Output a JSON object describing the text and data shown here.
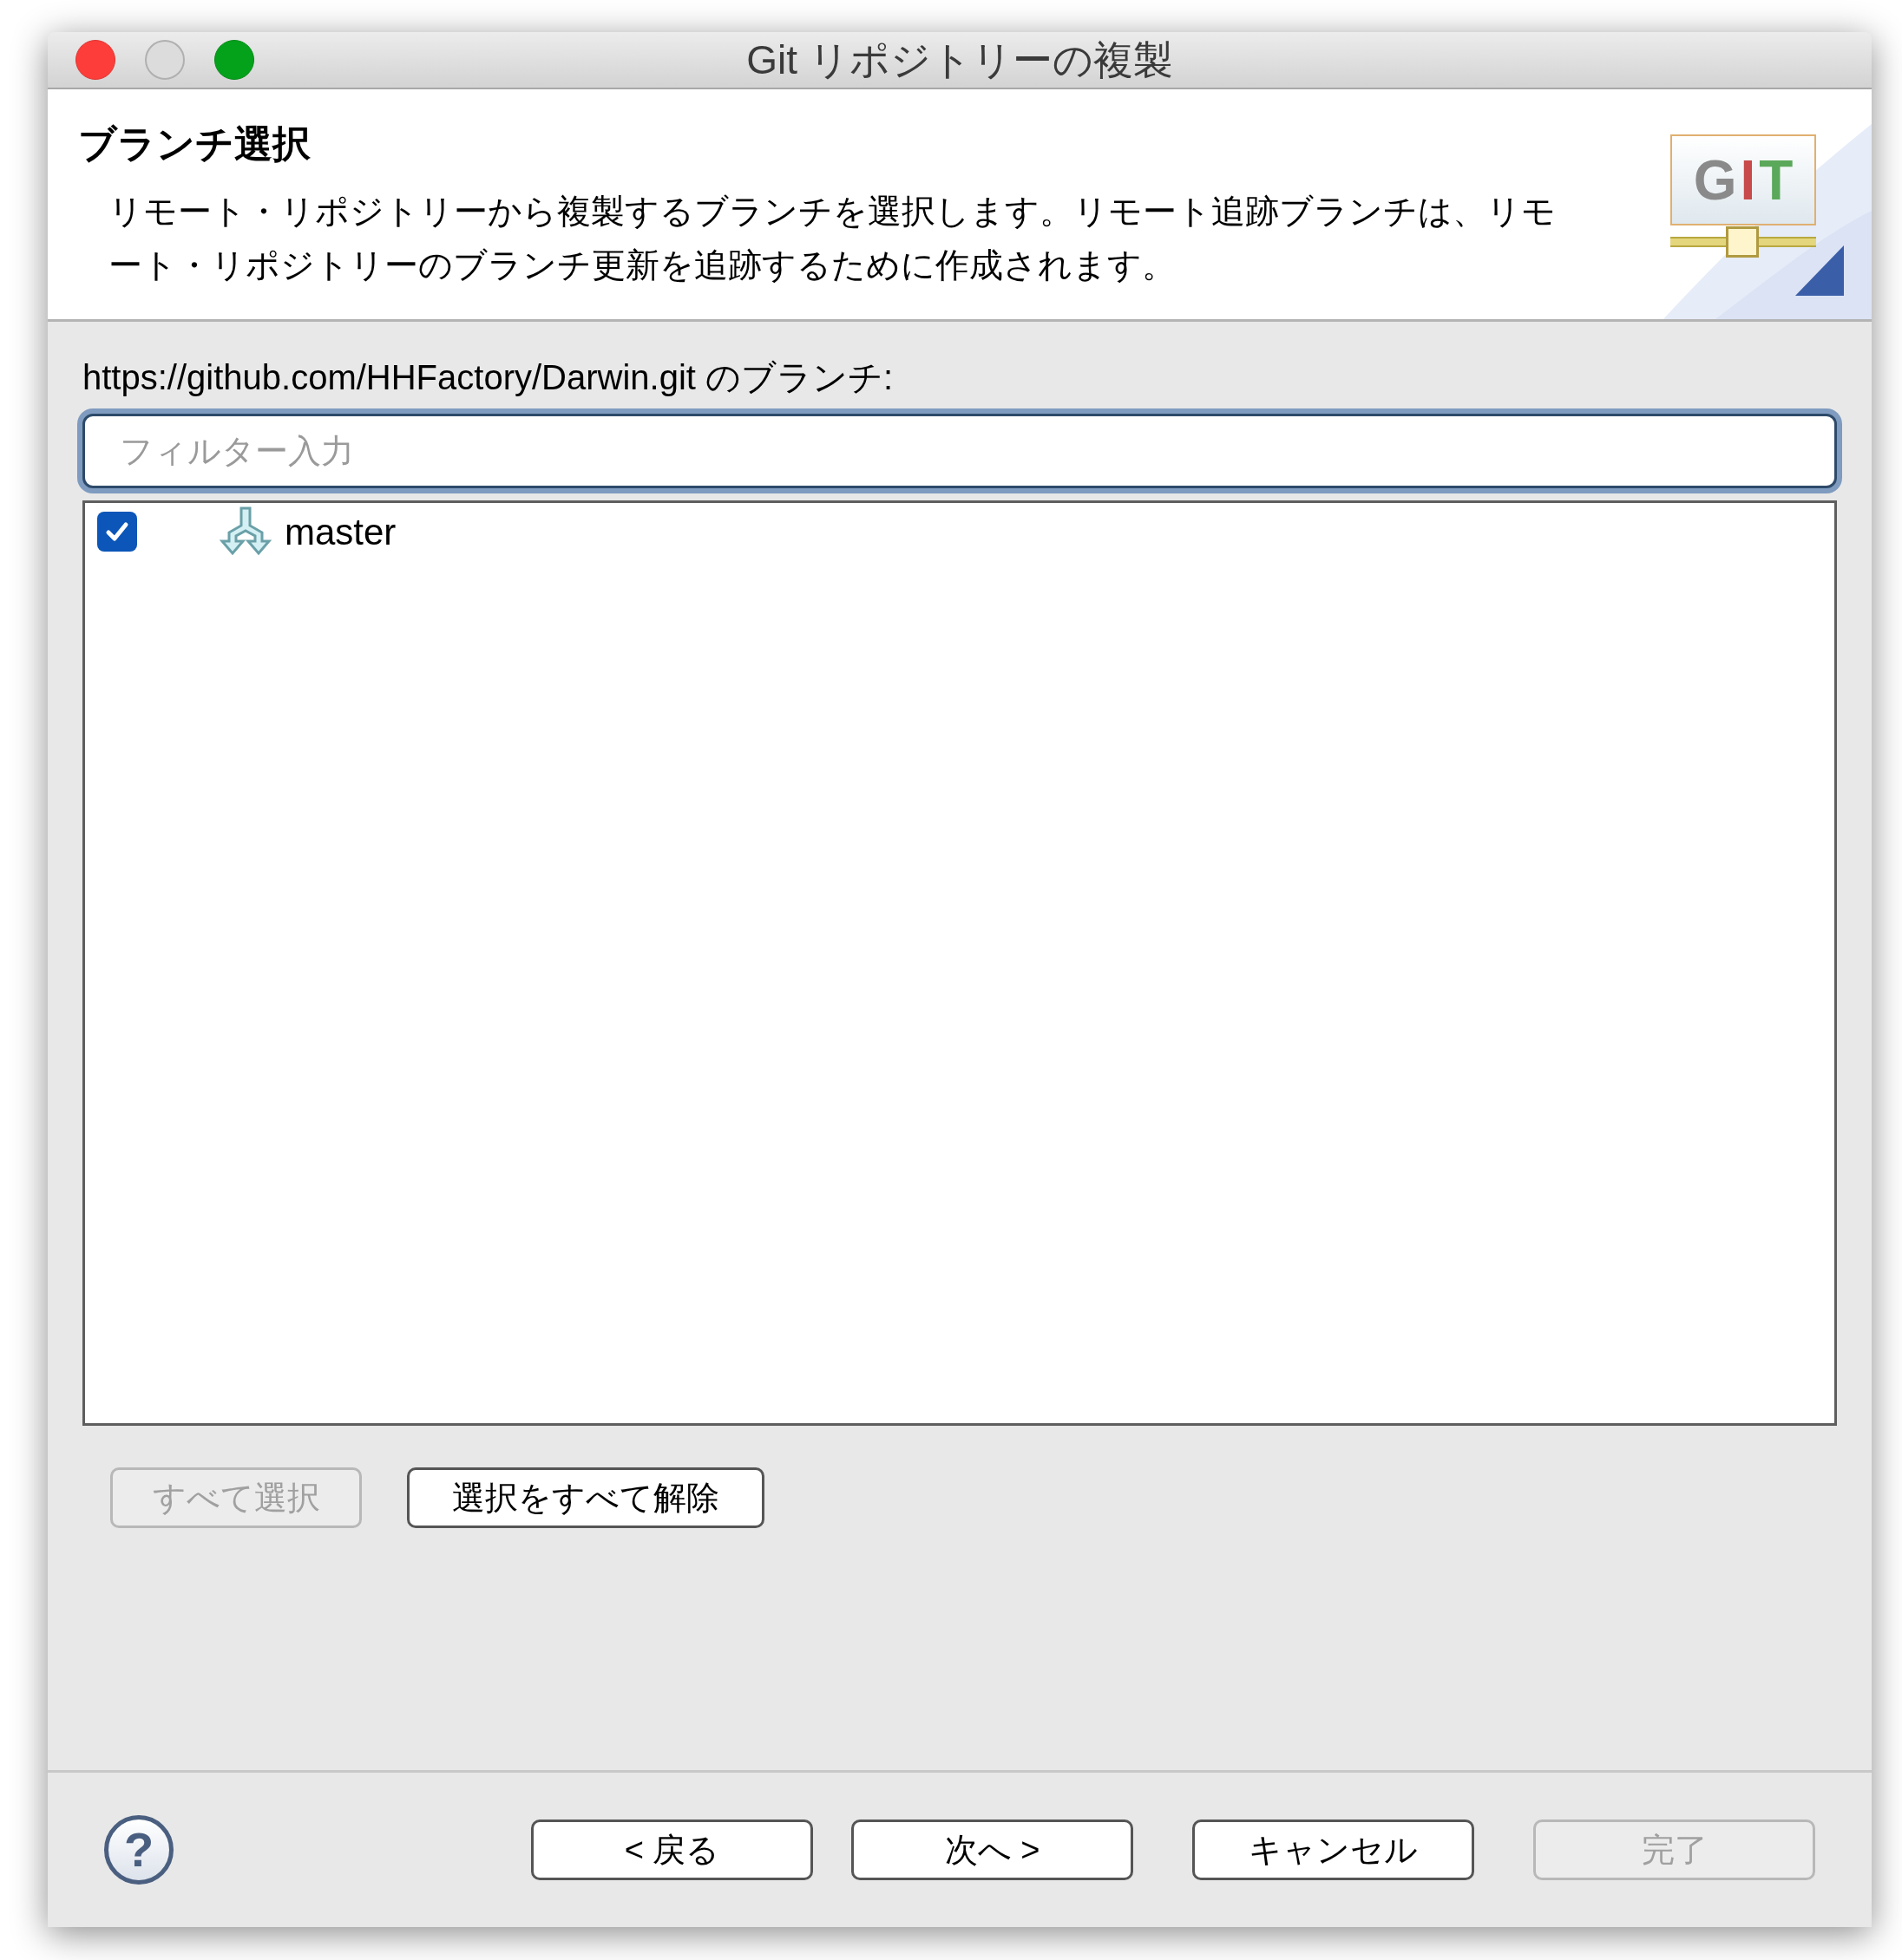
{
  "window": {
    "title": "Git リポジトリーの複製"
  },
  "header": {
    "title": "ブランチ選択",
    "description": "リモート・リポジトリーから複製するブランチを選択します。リモート追跡ブランチは、リモート・リポジトリーのブランチ更新を追跡するために作成されます。",
    "logo_letters": [
      "G",
      "I",
      "T"
    ]
  },
  "branches_label": "https://github.com/HHFactory/Darwin.git のブランチ:",
  "filter": {
    "placeholder": "フィルター入力"
  },
  "branches": [
    {
      "name": "master",
      "checked": true
    }
  ],
  "selection_buttons": [
    {
      "label": "すべて選択",
      "disabled": true
    },
    {
      "label": "選択をすべて解除",
      "disabled": false
    }
  ],
  "help_button": "?",
  "nav_buttons": [
    {
      "label": "< 戻る",
      "disabled": false
    },
    {
      "label": "次へ >",
      "disabled": false
    },
    {
      "label": "キャンセル",
      "disabled": false
    },
    {
      "label": "完了",
      "disabled": true
    }
  ]
}
